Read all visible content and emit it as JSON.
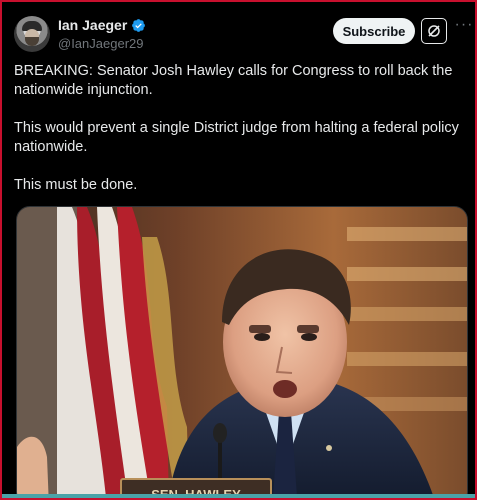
{
  "post": {
    "display_name": "Ian Jaeger",
    "handle": "@IanJaeger29",
    "subscribe_label": "Subscribe",
    "more_label": "···",
    "paragraphs": [
      "BREAKING: Senator Josh Hawley calls for Congress to roll back the nationwide injunction.",
      "This would prevent a single District judge from halting a federal policy nationwide.",
      "This must be done."
    ]
  },
  "media": {
    "nameplate_text": "SEN. HAWLEY"
  },
  "colors": {
    "verified": "#1d9bf0",
    "frame_border": "#c8102e"
  }
}
